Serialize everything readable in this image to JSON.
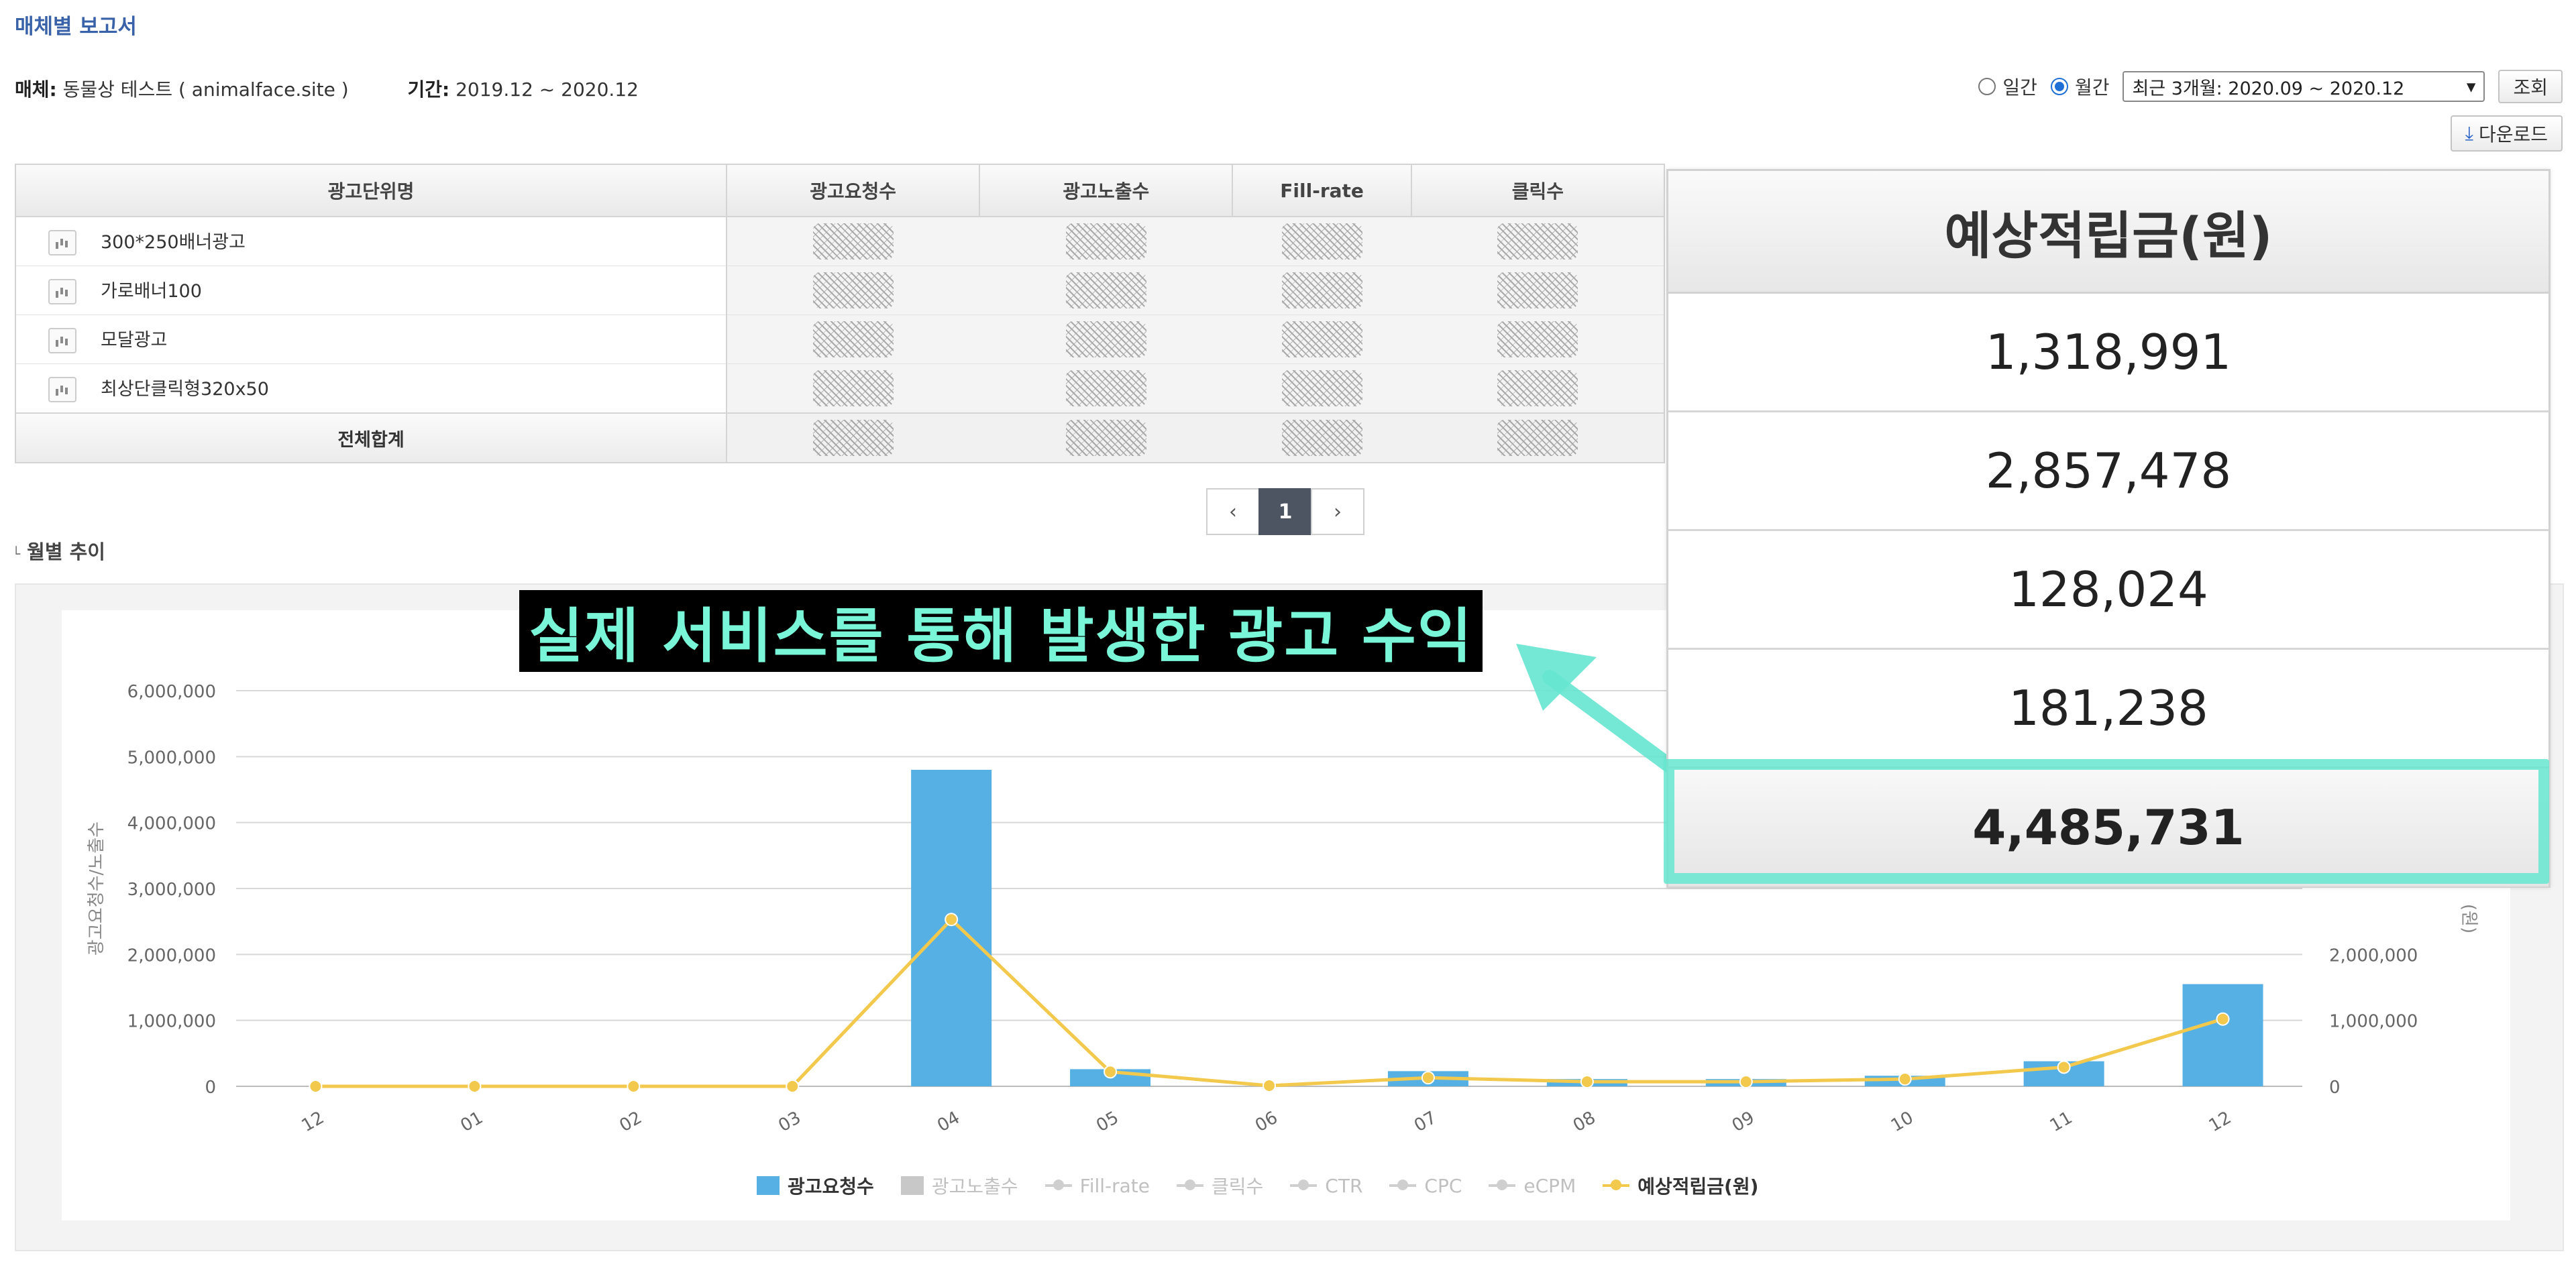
{
  "header": {
    "title": "매체별 보고서"
  },
  "info": {
    "media_label": "매체:",
    "media_value": "동물상 테스트 ( animalface.site )",
    "period_label": "기간:",
    "period_value": "2019.12 ~ 2020.12"
  },
  "controls": {
    "daily_label": "일간",
    "monthly_label": "월간",
    "range_select": "최근 3개월: 2020.09 ~ 2020.12",
    "search_button": "조회",
    "download_button": "다운로드"
  },
  "table": {
    "columns": [
      "광고단위명",
      "광고요청수",
      "광고노출수",
      "Fill-rate",
      "클릭수"
    ],
    "rows": [
      {
        "name": "300*250배너광고"
      },
      {
        "name": "가로배너100"
      },
      {
        "name": "모달광고"
      },
      {
        "name": "최상단클릭형320x50"
      }
    ],
    "total_label": "전체합계"
  },
  "pager": {
    "current": "1"
  },
  "section": {
    "title": "월별 추이"
  },
  "banner": {
    "text": "실제 서비스를 통해 발생한 광고 수익"
  },
  "revenue_panel": {
    "header": "예상적립금(원)",
    "values": [
      "1,318,991",
      "2,857,478",
      "128,024",
      "181,238"
    ],
    "total": "4,485,731"
  },
  "colors": {
    "bar": "#56b0e3",
    "line": "#f2c94c",
    "highlight": "#66e6d0",
    "title": "#3a62a8"
  },
  "chart_data": {
    "type": "bar",
    "categories": [
      "12",
      "01",
      "02",
      "03",
      "04",
      "05",
      "06",
      "07",
      "08",
      "09",
      "10",
      "11",
      "12"
    ],
    "ylabel": "광고요청수/노출수",
    "y2label": "(원)",
    "ylim": [
      0,
      6000000
    ],
    "y2lim": [
      0,
      6000000
    ],
    "yticks": [
      "0",
      "1,000,000",
      "2,000,000",
      "3,000,000",
      "4,000,000",
      "5,000,000",
      "6,000,000"
    ],
    "y2ticks": [
      "0",
      "1,000,000",
      "2,000,000"
    ],
    "series": [
      {
        "name": "광고요청수",
        "type": "bar",
        "values": [
          0,
          0,
          0,
          0,
          4800000,
          260000,
          0,
          230000,
          110000,
          110000,
          160000,
          380000,
          1550000
        ]
      },
      {
        "name": "예상적립금(원)",
        "type": "line",
        "axis": "right",
        "values": [
          0,
          0,
          0,
          0,
          2530000,
          220000,
          10000,
          130000,
          70000,
          70000,
          110000,
          290000,
          1020000
        ]
      }
    ],
    "legend": [
      "광고요청수",
      "광고노출수",
      "Fill-rate",
      "클릭수",
      "CTR",
      "CPC",
      "eCPM",
      "예상적립금(원)"
    ],
    "legend_position": "bottom",
    "grid": true
  }
}
